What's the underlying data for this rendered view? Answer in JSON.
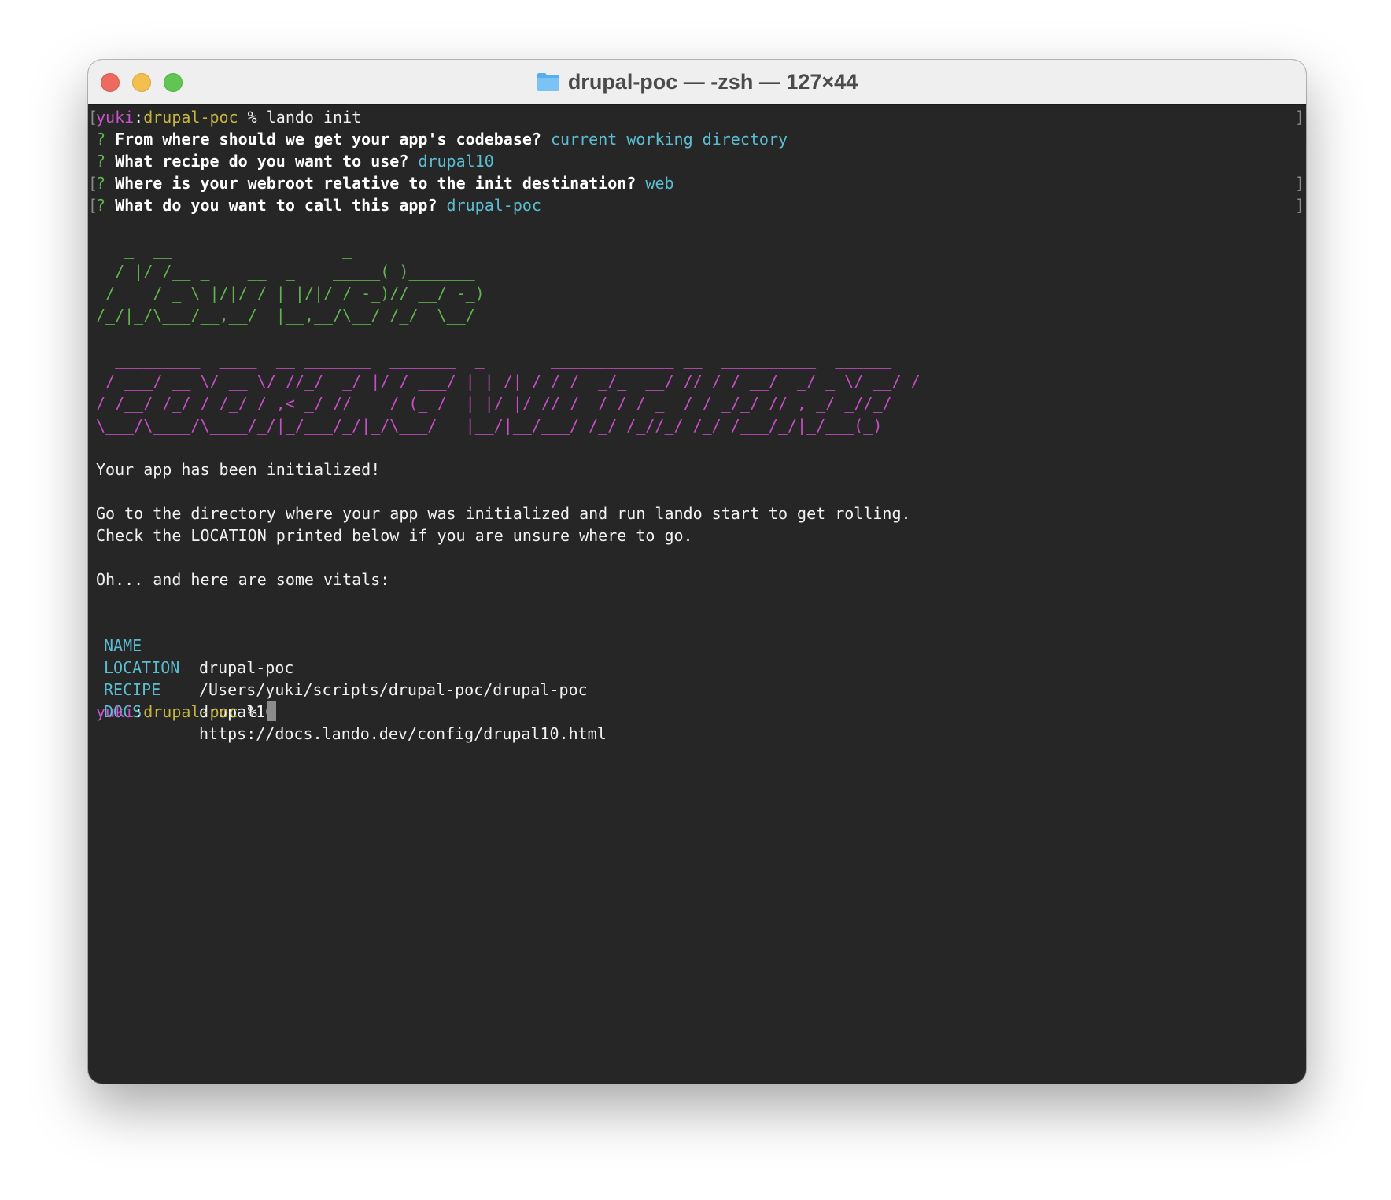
{
  "window": {
    "title": "drupal-poc — -zsh — 127×44",
    "folder_icon": "folder-icon"
  },
  "prompt": {
    "user": "yuki",
    "sep": ":",
    "dir": "drupal-poc",
    "symbol": " % ",
    "command": "lando init"
  },
  "questions": [
    {
      "mark": "? ",
      "text": "From where should we get your app's codebase?",
      "answer": "current working directory"
    },
    {
      "mark": "? ",
      "text": "What recipe do you want to use?",
      "answer": "drupal10"
    },
    {
      "mark": "? ",
      "text": "Where is your webroot relative to the init destination?",
      "answer": "web"
    },
    {
      "mark": "? ",
      "text": "What do you want to call this app?",
      "answer": "drupal-poc"
    }
  ],
  "ascii_now": [
    "   _  __                  _",
    "  / |/ /__ _    __  _    _____( )_______",
    " /    / _ \\ |/|/ / | |/|/ / -_)// __/ -_)",
    "/_/|_/\\___/__,__/  |__,__/\\__/ /_/  \\__/"
  ],
  "ascii_cooking": [
    "  _________  ____  __ _______  _______  _       _____________ __  __________  ______",
    " / ___/ __ \\/ __ \\/ //_/  _/ |/ / ___/ | | /| / / /  _/_  __/ // / / __/  _/ _ \\/ __/ /",
    "/ /__/ /_/ / /_/ / ,< _/ //    / (_ /  | |/ |/ // /  / / / _  / / _/_/ // , _/ _//_/",
    "\\___/\\____/\\____/_/|_/___/_/|_/\\___/   |__/|__/___/ /_/ /_//_/ /_/ /___/_/|_/___(_)"
  ],
  "messages": {
    "initialized": "Your app has been initialized!",
    "go_to": "Go to the directory where your app was initialized and run lando start to get rolling.",
    "check": "Check the LOCATION printed below if you are unsure where to go.",
    "vitals_intro": "Oh... and here are some vitals:"
  },
  "vitals": [
    {
      "key": "NAME",
      "value": "drupal-poc"
    },
    {
      "key": "LOCATION",
      "value": "/Users/yuki/scripts/drupal-poc/drupal-poc"
    },
    {
      "key": "RECIPE",
      "value": "drupal10"
    },
    {
      "key": "DOCS",
      "value": "https://docs.lando.dev/config/drupal10.html"
    }
  ],
  "colors": {
    "terminal_bg": "#262626",
    "user": "#c654c9",
    "host": "#c5b63e",
    "answer": "#5bbdd1",
    "ascii_green": "#5fb74c",
    "ascii_magenta": "#c84ec8"
  }
}
